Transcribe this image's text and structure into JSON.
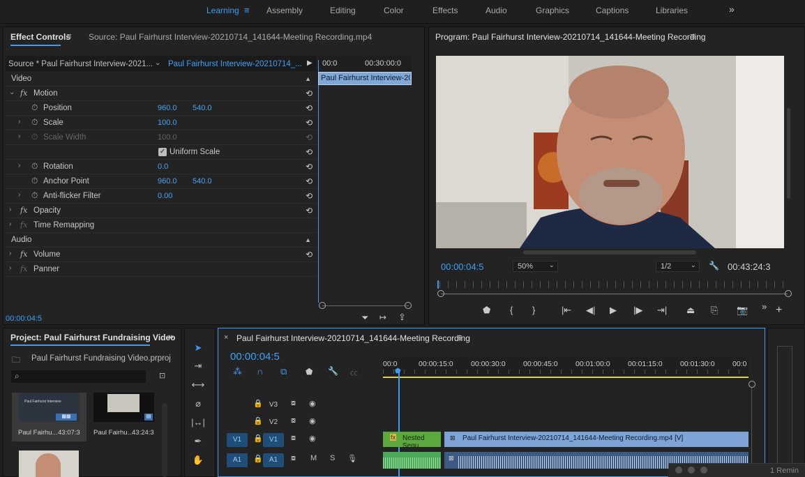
{
  "workspaces": [
    "Learning",
    "Assembly",
    "Editing",
    "Color",
    "Effects",
    "Audio",
    "Graphics",
    "Captions",
    "Libraries"
  ],
  "active_workspace": "Learning",
  "effect_controls": {
    "tab": "Effect Controls",
    "source_tab": "Source: Paul Fairhurst Interview-20210714_141644-Meeting Recording.mp4",
    "source_label": "Source * Paul Fairhurst Interview-2021...",
    "sequence_label": "Paul Fairhurst Interview-20210714_...",
    "ruler_start": "00:0",
    "ruler_mid": "00:30:00:0",
    "clip_label": "Paul Fairhurst Interview-20",
    "video_header": "Video",
    "audio_header": "Audio",
    "motion": "Motion",
    "position": {
      "label": "Position",
      "x": "960.0",
      "y": "540.0"
    },
    "scale": {
      "label": "Scale",
      "value": "100.0"
    },
    "scale_width": {
      "label": "Scale Width",
      "value": "100.0"
    },
    "uniform_scale": "Uniform Scale",
    "rotation": {
      "label": "Rotation",
      "value": "0.0"
    },
    "anchor_point": {
      "label": "Anchor Point",
      "x": "960.0",
      "y": "540.0"
    },
    "anti_flicker": {
      "label": "Anti-flicker Filter",
      "value": "0.00"
    },
    "opacity": "Opacity",
    "time_remapping": "Time Remapping",
    "volume": "Volume",
    "panner": "Panner",
    "timecode": "00:00:04:5"
  },
  "program": {
    "title": "Program: Paul Fairhurst Interview-20210714_141644-Meeting Recording",
    "timecode": "00:00:04:5",
    "zoom": "50%",
    "resolution": "1/2",
    "duration": "00:43:24:3"
  },
  "project": {
    "title": "Project: Paul Fairhurst Fundraising Video",
    "file": "Paul Fairhurst Fundraising Video.prproj",
    "items": [
      {
        "name": "Paul Fairhu...",
        "duration": "43:07:3",
        "thumb_text": "Paul Fairhurst Interview"
      },
      {
        "name": "Paul Fairhu...",
        "duration": "43:24:3"
      }
    ]
  },
  "timeline": {
    "title": "Paul Fairhurst Interview-20210714_141644-Meeting Recording",
    "timecode": "00:00:04:5",
    "ruler": [
      "00:0",
      "00:00:15:0",
      "00:00:30:0",
      "00:00:45:0",
      "00:01:00:0",
      "00:01:15:0",
      "00:01:30:0",
      "00:0"
    ],
    "tracks": [
      {
        "name": "V3"
      },
      {
        "name": "V2"
      },
      {
        "name": "V1",
        "src": "V1"
      },
      {
        "name": "A1",
        "src": "A1",
        "m": "M",
        "s": "S"
      }
    ],
    "nested_clip": "Nested Sequ",
    "video_clip": "Paul Fairhurst Interview-20210714_141644-Meeting Recording.mp4 [V]"
  },
  "reminder": "1 Remin",
  "colors": {
    "accent": "#3f9cf2",
    "playhead": "#3f9cf2",
    "video_clip": "#7ea3d6",
    "nested_clip": "#5ba93c",
    "audio_clip": "#4da95a"
  }
}
